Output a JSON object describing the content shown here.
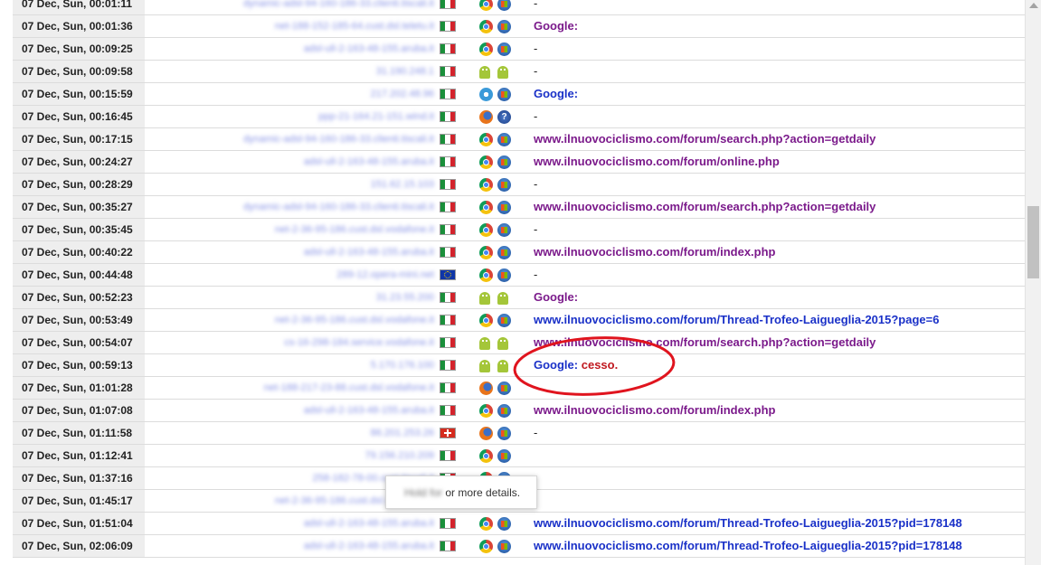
{
  "rows": [
    {
      "date": "07 Dec, Sun, 00:01:11",
      "host": "dynamic-adsl-94-160-186-33.clienti.tiscali.it",
      "flag": "it",
      "b1": "chrome",
      "b2": "win",
      "ref": "-",
      "style": "plain"
    },
    {
      "date": "07 Dec, Sun, 00:01:36",
      "host": "net-188-152-185-64.cust.dsl.teletu.it",
      "flag": "it",
      "b1": "chrome",
      "b2": "win",
      "ref": "Google:",
      "style": "purple"
    },
    {
      "date": "07 Dec, Sun, 00:09:25",
      "host": "adsl-ull-2-163-48-155.aruba.it",
      "flag": "it",
      "b1": "chrome",
      "b2": "win",
      "ref": "-",
      "style": "plain"
    },
    {
      "date": "07 Dec, Sun, 00:09:58",
      "host": "31.190.248.1",
      "flag": "it",
      "b1": "android",
      "b2": "android",
      "ref": "-",
      "style": "plain"
    },
    {
      "date": "07 Dec, Sun, 00:15:59",
      "host": "217.202.48.96",
      "flag": "it",
      "b1": "ie",
      "b2": "win",
      "ref": "Google:",
      "style": "blue"
    },
    {
      "date": "07 Dec, Sun, 00:16:45",
      "host": "ppp-21-164.21-151.wind.it",
      "flag": "it",
      "b1": "firefox",
      "b2": "macq",
      "ref": "-",
      "style": "plain"
    },
    {
      "date": "07 Dec, Sun, 00:17:15",
      "host": "dynamic-adsl-94-160-186-33.clienti.tiscali.it",
      "flag": "it",
      "b1": "chrome",
      "b2": "win",
      "ref": "www.ilnuovociclismo.com/forum/search.php?action=getdaily",
      "style": "purple"
    },
    {
      "date": "07 Dec, Sun, 00:24:27",
      "host": "adsl-ull-2-163-48-155.aruba.it",
      "flag": "it",
      "b1": "chrome",
      "b2": "win",
      "ref": "www.ilnuovociclismo.com/forum/online.php",
      "style": "purple"
    },
    {
      "date": "07 Dec, Sun, 00:28:29",
      "host": "151.62.15.103",
      "flag": "it",
      "b1": "chrome",
      "b2": "win",
      "ref": "-",
      "style": "plain"
    },
    {
      "date": "07 Dec, Sun, 00:35:27",
      "host": "dynamic-adsl-94-160-186-33.clienti.tiscali.it",
      "flag": "it",
      "b1": "chrome",
      "b2": "win",
      "ref": "www.ilnuovociclismo.com/forum/search.php?action=getdaily",
      "style": "purple"
    },
    {
      "date": "07 Dec, Sun, 00:35:45",
      "host": "net-2-36-95-186.cust.dsl.vodafone.it",
      "flag": "it",
      "b1": "chrome",
      "b2": "win",
      "ref": "-",
      "style": "plain"
    },
    {
      "date": "07 Dec, Sun, 00:40:22",
      "host": "adsl-ull-2-163-48-155.aruba.it",
      "flag": "it",
      "b1": "chrome",
      "b2": "win",
      "ref": "www.ilnuovociclismo.com/forum/index.php",
      "style": "purple"
    },
    {
      "date": "07 Dec, Sun, 00:44:48",
      "host": "289-12.opera-mini.net",
      "flag": "eu",
      "b1": "chrome",
      "b2": "win",
      "ref": "-",
      "style": "plain"
    },
    {
      "date": "07 Dec, Sun, 00:52:23",
      "host": "31.23.55.200",
      "flag": "it",
      "b1": "android",
      "b2": "android",
      "ref": "Google:",
      "style": "purple"
    },
    {
      "date": "07 Dec, Sun, 00:53:49",
      "host": "net-2-36-95-186.cust.dsl.vodafone.it",
      "flag": "it",
      "b1": "chrome",
      "b2": "win",
      "ref": "www.ilnuovociclismo.com/forum/Thread-Trofeo-Laigueglia-2015?page=6",
      "style": "blue"
    },
    {
      "date": "07 Dec, Sun, 00:54:07",
      "host": "cs-16-298-184.service.vodafone.it",
      "flag": "it",
      "b1": "android",
      "b2": "android",
      "ref": "www.ilnuovociclismo.com/forum/search.php?action=getdaily",
      "style": "purple"
    },
    {
      "date": "07 Dec, Sun, 00:59:13",
      "host": "5.170.176.100",
      "flag": "it",
      "b1": "android",
      "b2": "android",
      "ref": "Google:",
      "ref_kw": "cesso.",
      "style": "blue"
    },
    {
      "date": "07 Dec, Sun, 01:01:28",
      "host": "net-188-217-23-88.cust.dsl.vodafone.it",
      "flag": "it",
      "b1": "firefox",
      "b2": "win",
      "ref": "",
      "style": "plain"
    },
    {
      "date": "07 Dec, Sun, 01:07:08",
      "host": "adsl-ull-2-163-48-155.aruba.it",
      "flag": "it",
      "b1": "chrome",
      "b2": "win",
      "ref": "www.ilnuovociclismo.com/forum/index.php",
      "style": "purple"
    },
    {
      "date": "07 Dec, Sun, 01:11:58",
      "host": "86.201.253.26",
      "flag": "ch",
      "b1": "firefox",
      "b2": "win",
      "ref": "-",
      "style": "plain"
    },
    {
      "date": "07 Dec, Sun, 01:12:41",
      "host": "79.156.210.209",
      "flag": "it",
      "b1": "chrome",
      "b2": "win",
      "ref": "",
      "style": "plain"
    },
    {
      "date": "07 Dec, Sun, 01:37:16",
      "host": "258-182-78-00.cust.tiscali.it",
      "flag": "it",
      "b1": "chrome",
      "b2": "win",
      "ref": "",
      "style": "plain"
    },
    {
      "date": "07 Dec, Sun, 01:45:17",
      "host": "net-2-36-95-186.cust.dsl.vodafone.it",
      "flag": "it",
      "b1": "chrome",
      "b2": "win",
      "ref": "",
      "style": "plain"
    },
    {
      "date": "07 Dec, Sun, 01:51:04",
      "host": "adsl-ull-2-163-48-155.aruba.it",
      "flag": "it",
      "b1": "chrome",
      "b2": "win",
      "ref": "www.ilnuovociclismo.com/forum/Thread-Trofeo-Laigueglia-2015?pid=178148",
      "style": "blue"
    },
    {
      "date": "07 Dec, Sun, 02:06:09",
      "host": "adsl-ull-2-163-48-155.aruba.it",
      "flag": "it",
      "b1": "chrome",
      "b2": "win",
      "ref": "www.ilnuovociclismo.com/forum/Thread-Trofeo-Laigueglia-2015?pid=178148",
      "style": "blue"
    }
  ],
  "tooltip": {
    "blurred": "Hold for",
    "text": "or more details."
  },
  "colors": {
    "annotation_circle": "#e0141e",
    "link_purple": "#7b1a8b",
    "link_blue": "#1a31c8"
  }
}
